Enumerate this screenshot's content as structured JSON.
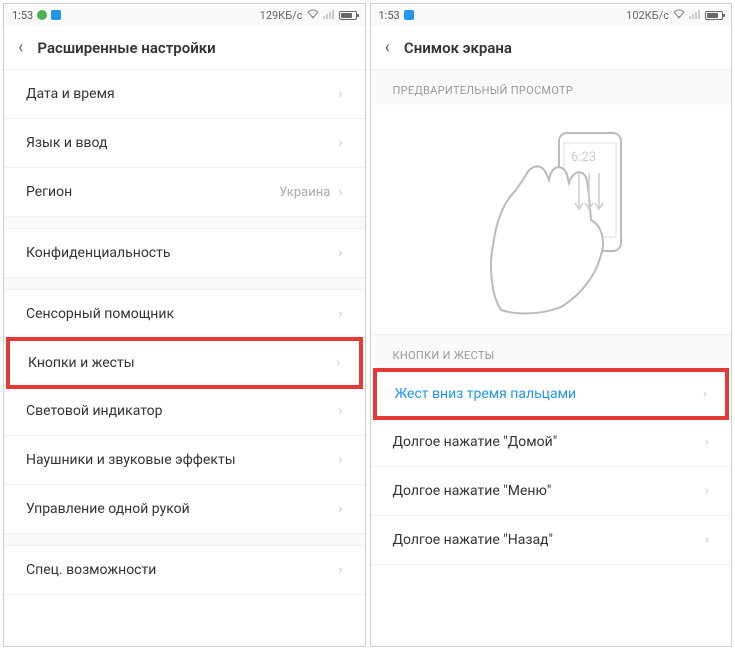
{
  "leftPhone": {
    "status": {
      "time": "1:53",
      "dataRate": "129КБ/с"
    },
    "header": {
      "title": "Расширенные настройки"
    },
    "items": [
      {
        "label": "Дата и время",
        "value": ""
      },
      {
        "label": "Язык и ввод",
        "value": ""
      },
      {
        "label": "Регион",
        "value": "Украина"
      },
      {
        "label": "Конфиденциальность",
        "value": ""
      },
      {
        "label": "Сенсорный помощник",
        "value": ""
      },
      {
        "label": "Кнопки и жесты",
        "value": "",
        "highlighted": true
      },
      {
        "label": "Световой индикатор",
        "value": ""
      },
      {
        "label": "Наушники и звуковые эффекты",
        "value": ""
      },
      {
        "label": "Управление одной рукой",
        "value": ""
      },
      {
        "label": "Спец. возможности",
        "value": ""
      }
    ]
  },
  "rightPhone": {
    "status": {
      "time": "1:53",
      "dataRate": "102КБ/с"
    },
    "header": {
      "title": "Снимок экрана"
    },
    "previewLabel": "ПРЕДВАРИТЕЛЬНЫЙ ПРОСМОТР",
    "previewTime": "6:23",
    "sectionLabel": "КНОПКИ И ЖЕСТЫ",
    "items": [
      {
        "label": "Жест вниз тремя пальцами",
        "highlighted": true,
        "blue": true
      },
      {
        "label": "Долгое нажатие \"Домой\""
      },
      {
        "label": "Долгое нажатие \"Меню\""
      },
      {
        "label": "Долгое нажатие \"Назад\""
      }
    ]
  }
}
